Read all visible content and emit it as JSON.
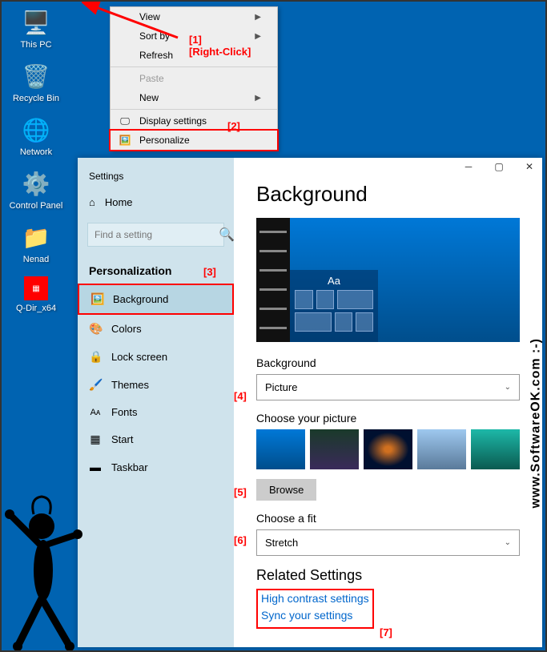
{
  "desktop": {
    "icons": [
      {
        "label": "This PC"
      },
      {
        "label": "Recycle Bin"
      },
      {
        "label": "Network"
      },
      {
        "label": "Control Panel"
      },
      {
        "label": "Nenad"
      },
      {
        "label": "Q-Dir_x64"
      }
    ]
  },
  "contextMenu": {
    "items": {
      "view": "View",
      "sortBy": "Sort by",
      "refresh": "Refresh",
      "paste": "Paste",
      "new": "New",
      "displaySettings": "Display settings",
      "personalize": "Personalize"
    }
  },
  "annotations": {
    "a1": "[1]",
    "rightClick": "[Right-Click]",
    "a2": "[2]",
    "a3": "[3]",
    "a4": "[4]",
    "a5": "[5]",
    "a6": "[6]",
    "a7": "[7]"
  },
  "settings": {
    "appTitle": "Settings",
    "home": "Home",
    "searchPlaceholder": "Find a setting",
    "section": "Personalization",
    "nav": {
      "background": "Background",
      "colors": "Colors",
      "lockScreen": "Lock screen",
      "themes": "Themes",
      "fonts": "Fonts",
      "start": "Start",
      "taskbar": "Taskbar"
    },
    "content": {
      "title": "Background",
      "previewText": "Aa",
      "backgroundLabel": "Background",
      "backgroundValue": "Picture",
      "choosePicture": "Choose your picture",
      "browse": "Browse",
      "chooseFit": "Choose a fit",
      "fitValue": "Stretch",
      "relatedTitle": "Related Settings",
      "link1": "High contrast settings",
      "link2": "Sync your settings"
    }
  },
  "watermark": "www.SoftwareOK.com :-)"
}
